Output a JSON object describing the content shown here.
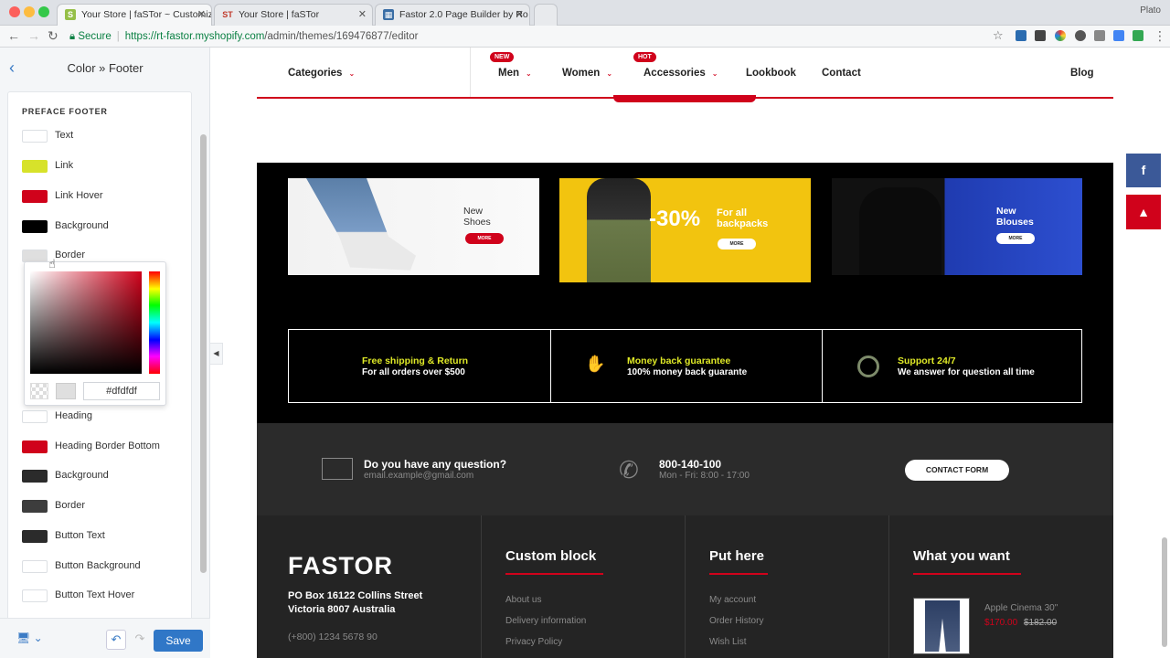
{
  "browser": {
    "tabs": [
      {
        "label": "Your Store | faSTor ~ Customiz",
        "active": true
      },
      {
        "label": "Your Store | faSTor",
        "active": false
      },
      {
        "label": "Fastor 2.0 Page Builder by Ro",
        "active": false
      }
    ],
    "profile": "Plato",
    "secure_label": "Secure",
    "url_host": "https://rt-fastor.myshopify.com",
    "url_path": "/admin/themes/169476877/editor"
  },
  "sidebar": {
    "title": "Color » Footer",
    "section_label": "PREFACE FOOTER",
    "preface_items": [
      {
        "label": "Text",
        "color": "#ffffff"
      },
      {
        "label": "Link",
        "color": "#d7e22a"
      },
      {
        "label": "Link Hover",
        "color": "#d0021b"
      },
      {
        "label": "Background",
        "color": "#000000"
      },
      {
        "label": "Border",
        "color": "#dfdfdf"
      }
    ],
    "footer_items": [
      {
        "label": "Heading",
        "color": "#ffffff"
      },
      {
        "label": "Heading Border Bottom",
        "color": "#d0021b"
      },
      {
        "label": "Background",
        "color": "#2b2b2b"
      },
      {
        "label": "Border",
        "color": "#3d3d3d"
      },
      {
        "label": "Button Text",
        "color": "#2b2b2b"
      },
      {
        "label": "Button Background",
        "color": "#ffffff"
      },
      {
        "label": "Button Text Hover",
        "color": "#ffffff"
      }
    ],
    "picker_hex": "#dfdfdf",
    "save_label": "Save"
  },
  "store": {
    "nav": {
      "categories": "Categories",
      "items": [
        {
          "label": "Men",
          "badge": "NEW",
          "dropdown": true
        },
        {
          "label": "Women",
          "badge": "",
          "dropdown": true
        },
        {
          "label": "Accessories",
          "badge": "HOT",
          "dropdown": true
        },
        {
          "label": "Lookbook",
          "badge": "",
          "dropdown": false
        },
        {
          "label": "Contact",
          "badge": "",
          "dropdown": false
        }
      ],
      "blog": "Blog"
    },
    "banners": [
      {
        "text": "New Shoes",
        "button": "MORE"
      },
      {
        "pct": "-30%",
        "text": "For all backpacks",
        "button": "MORE"
      },
      {
        "text": "New Blouses",
        "button": "MORE"
      }
    ],
    "features": [
      {
        "title": "Free shipping & Return",
        "sub": "For all orders over $500"
      },
      {
        "title": "Money back guarantee",
        "sub": "100% money back guarante"
      },
      {
        "title": "Support 24/7",
        "sub": "We answer for question all time"
      }
    ],
    "contact": {
      "question": "Do you have any question?",
      "email": "email.example@gmail.com",
      "phone": "800-140-100",
      "hours": "Mon - Fri: 8:00 - 17:00",
      "button": "CONTACT FORM"
    },
    "footer": {
      "logo": "FASTOR",
      "address_1": "PO Box 16122 Collins Street",
      "address_2": "Victoria 8007 Australia",
      "phone": "(+800) 1234 5678 90",
      "col1": {
        "heading": "Custom block",
        "links": [
          "About us",
          "Delivery information",
          "Privacy Policy"
        ]
      },
      "col2": {
        "heading": "Put here",
        "links": [
          "My account",
          "Order History",
          "Wish List"
        ]
      },
      "col3": {
        "heading": "What you want",
        "product": "Apple Cinema 30\"",
        "price_new": "$170.00",
        "price_old": "$182.00"
      }
    }
  }
}
